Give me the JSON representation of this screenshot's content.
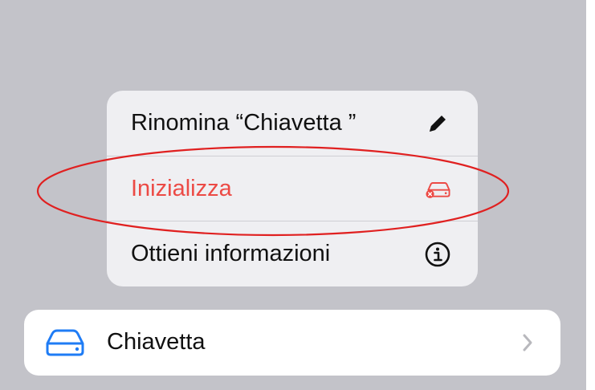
{
  "menu": {
    "items": [
      {
        "label": "Rinomina “Chiavetta ”",
        "icon": "pencil-icon"
      },
      {
        "label": "Inizializza",
        "icon": "erase-drive-icon",
        "destructive": true
      },
      {
        "label": "Ottieni informazioni",
        "icon": "info-circle-icon"
      }
    ]
  },
  "list": {
    "row": {
      "label": "Chiavetta",
      "icon": "drive-icon"
    }
  },
  "colors": {
    "background": "#c3c3c9",
    "menu_background": "#efeff2",
    "destructive": "#ec4a45",
    "accent": "#1f7cf5",
    "annotation": "#e02020"
  }
}
